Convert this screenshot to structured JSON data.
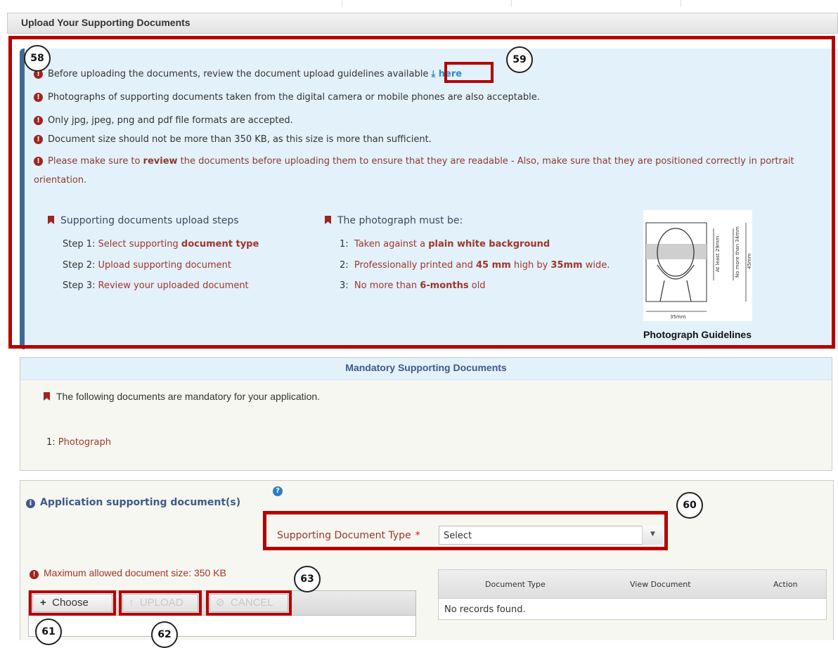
{
  "header": {
    "title": "Upload Your Supporting Documents"
  },
  "guidelines": {
    "notes": [
      {
        "text": "Before uploading the documents, review the document upload guidelines available",
        "link": "here"
      },
      {
        "text": "Photographs of supporting documents taken from the digital camera or mobile phones are also acceptable."
      },
      {
        "text": "Only jpg, jpeg, png and pdf file formats are accepted."
      },
      {
        "text": "Document size should not be more than 350 KB, as this size is more than sufficient."
      },
      {
        "pre": "Please make sure to ",
        "bold": "review",
        "post": " the documents before uploading them to ensure that they are readable - Also, make sure that they are positioned correctly in portrait",
        "line2": "orientation."
      }
    ],
    "steps_title": "Supporting documents upload steps",
    "steps": [
      {
        "label": "Step 1:",
        "pre": "Select supporting ",
        "bold": "document type"
      },
      {
        "label": "Step 2:",
        "pre": "Upload supporting document",
        "bold": ""
      },
      {
        "label": "Step 3:",
        "pre": "Review your uploaded document",
        "bold": ""
      }
    ],
    "photo_title": "The photograph must be:",
    "photo_rules": [
      {
        "label": "1:",
        "pre": "Taken against a ",
        "bold": "plain white background",
        "mid": "",
        "bold2": "",
        "post": ""
      },
      {
        "label": "2:",
        "pre": "Professionally printed and ",
        "bold": "45 mm",
        "mid": " high by ",
        "bold2": "35mm",
        "post": " wide."
      },
      {
        "label": "3:",
        "pre": "No more than ",
        "bold": "6-months",
        "mid": " old",
        "bold2": "",
        "post": ""
      }
    ],
    "photo_caption": "Photograph Guidelines",
    "photo_dims": {
      "width": "35mm",
      "height": "45mm",
      "head_min": "At least 29mm",
      "head_max": "No more than 34mm"
    }
  },
  "mandatory": {
    "title": "Mandatory Supporting Documents",
    "note": "The following documents are mandatory for your application.",
    "items": [
      {
        "num": "1:",
        "label": "Photograph"
      }
    ]
  },
  "application": {
    "title": "Application supporting document(s)",
    "doc_type_label": "Supporting Document Type",
    "required_mark": "*",
    "doc_type_value": "Select",
    "max_size": "Maximum allowed document size: 350 KB",
    "buttons": {
      "choose": "Choose",
      "upload": "UPLOAD",
      "cancel": "CANCEL"
    },
    "table": {
      "columns": [
        "Document Type",
        "View Document",
        "Action"
      ],
      "empty": "No records found."
    }
  },
  "callouts": [
    "58",
    "59",
    "60",
    "61",
    "62",
    "63"
  ],
  "colors": {
    "annotation_red": "#b50000",
    "info_bg": "#e3f1fb",
    "accent_blue": "#3e5a89",
    "text_red": "#a0352a"
  }
}
